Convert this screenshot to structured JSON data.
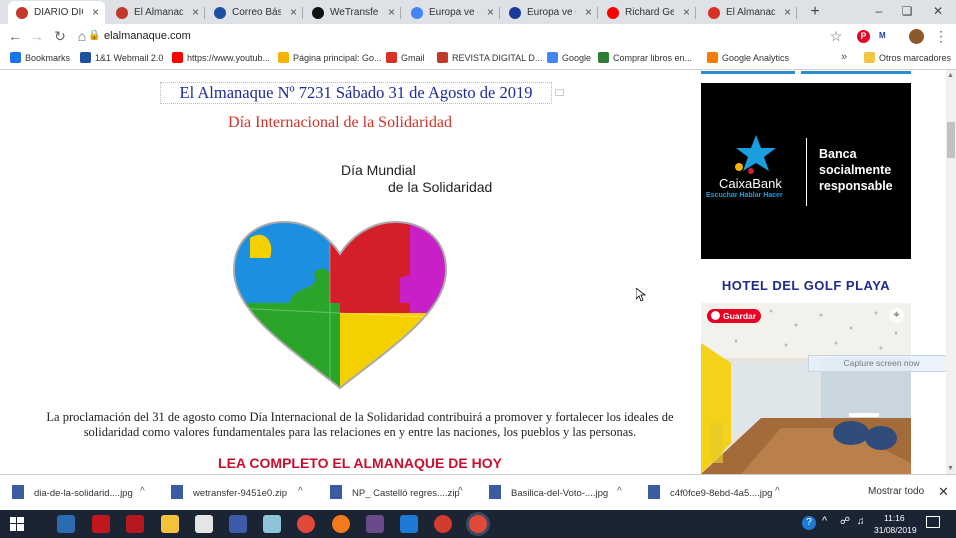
{
  "tabs": [
    {
      "label": "DIARIO DIGITAL",
      "favicon": "almanaque-icon",
      "color": "#c0392b",
      "active": true
    },
    {
      "label": "El Almanaque",
      "favicon": "almanaque-icon",
      "color": "#c0392b"
    },
    {
      "label": "Correo Básico",
      "favicon": "mail-icon",
      "color": "#1e4fa0"
    },
    {
      "label": "WeTransfer",
      "favicon": "wetransfer-icon",
      "color": "#111111"
    },
    {
      "label": "Europa ve en C",
      "favicon": "google-icon",
      "color": "#4285f4"
    },
    {
      "label": "Europa ve en C",
      "favicon": "e-icon",
      "color": "#1a3a9a"
    },
    {
      "label": "Richard Gere",
      "favicon": "youtube-icon",
      "color": "#ff0000"
    },
    {
      "label": "El Almanaque",
      "favicon": "gmail-icon",
      "color": "#d93025"
    }
  ],
  "toolbar": {
    "url": "elalmanaque.com"
  },
  "bookmarks": [
    {
      "label": "Bookmarks",
      "icon": "star-icon",
      "color": "#1a73e8"
    },
    {
      "label": "1&1 Webmail 2.0",
      "icon": "webmail-icon",
      "color": "#1e4fa0"
    },
    {
      "label": "https://www.youtub...",
      "icon": "youtube-icon",
      "color": "#ff0000"
    },
    {
      "label": "Página principal: Go...",
      "icon": "drive-icon",
      "color": "#f4b400"
    },
    {
      "label": "Gmail",
      "icon": "gmail-icon",
      "color": "#d93025"
    },
    {
      "label": "REVISTA DIGITAL D...",
      "icon": "almanaque-icon",
      "color": "#c0392b"
    },
    {
      "label": "Google",
      "icon": "google-icon",
      "color": "#4285f4"
    },
    {
      "label": "Comprar libros en...",
      "icon": "books-icon",
      "color": "#2e7d32"
    },
    {
      "label": "Google Analytics",
      "icon": "analytics-icon",
      "color": "#f57c00"
    },
    {
      "label": "Otros marcadores",
      "icon": "folder-icon",
      "color": "#f5c542"
    }
  ],
  "page": {
    "heading": "El Almanaque Nº 7231  Sábado 31 de Agosto de 2019",
    "day_title": "Día Internacional de la Solidaridad",
    "image_caption_line1": "Día Mundial",
    "image_caption_line2": "de la Solidaridad",
    "body_text": "La proclamación del 31 de agosto como Día Internacional de la Solidaridad contribuirá a promover y fortalecer los ideales de solidaridad como valores fundamentales para las relaciones en y entre las naciones, los pueblos y las personas.",
    "read_more": "LEA COMPLETO EL ALMANAQUE DE HOY"
  },
  "sidebar": {
    "banner": {
      "brand": "CaixaBank",
      "tagline": "Escuchar Hablar Hacer",
      "slogan_line1": "Banca",
      "slogan_line2": "socialmente",
      "slogan_line3": "responsable"
    },
    "hotel_title": "HOTEL DEL GOLF PLAYA",
    "save_button": "Guardar",
    "capture_label": "Capture screen now"
  },
  "downloads": [
    {
      "name": "dia-de-la-solidarid....jpg"
    },
    {
      "name": "wetransfer-9451e0.zip"
    },
    {
      "name": "NP_ Castelló regres....zip"
    },
    {
      "name": "Basilica-del-Voto-....jpg"
    },
    {
      "name": "c4f0fce9-8ebd-4a5....jpg"
    }
  ],
  "downloads_show_all": "Mostrar todo",
  "taskbar": {
    "time": "11:16",
    "date": "31/08/2019"
  }
}
